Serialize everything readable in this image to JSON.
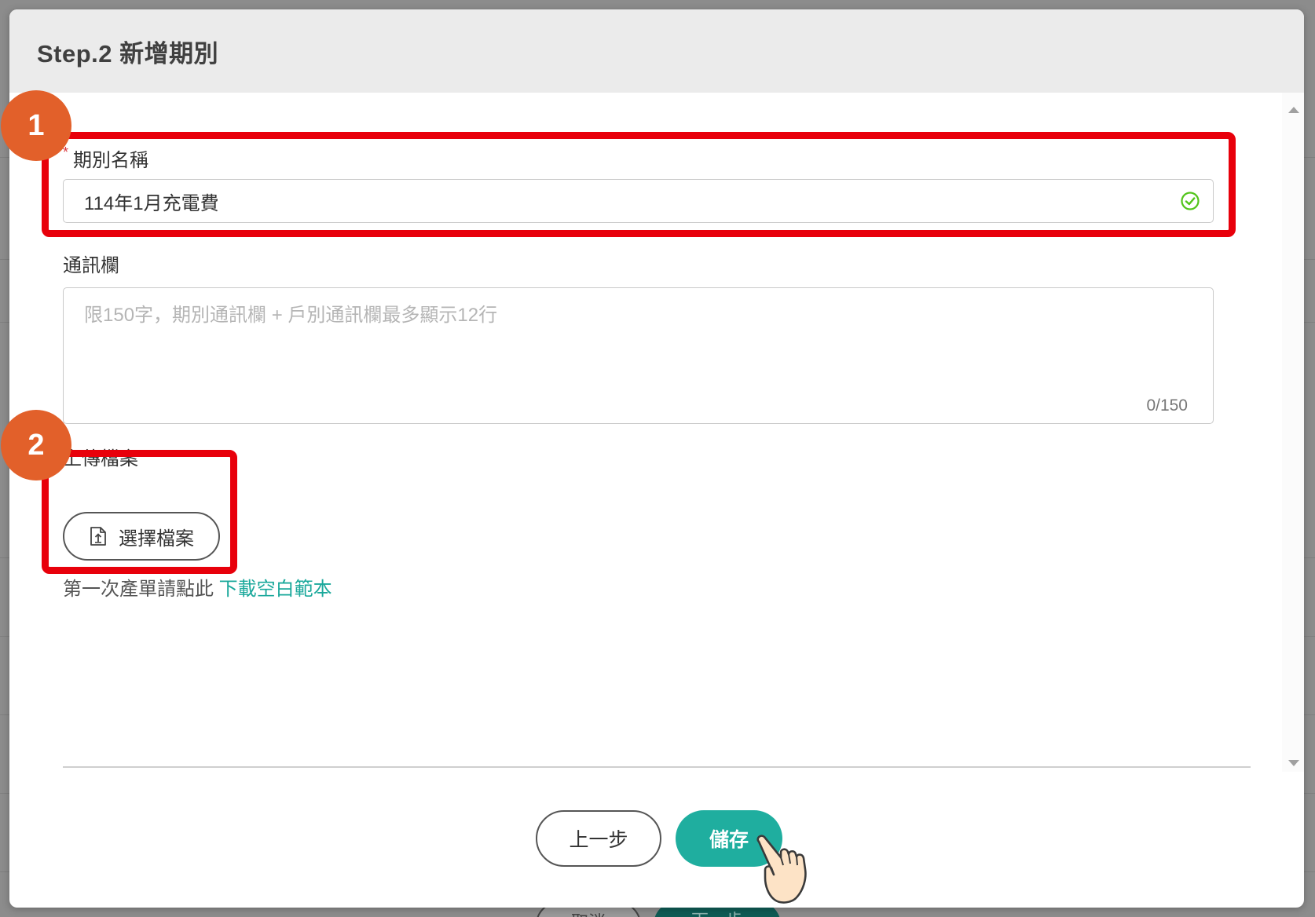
{
  "modal": {
    "title": "Step.2 新增期別"
  },
  "period_name": {
    "label": "期別名稱",
    "required_mark": "*",
    "value": "114年1月充電費"
  },
  "message": {
    "label": "通訊欄",
    "placeholder": "限150字，期別通訊欄 + 戶別通訊欄最多顯示12行",
    "counter": "0/150"
  },
  "upload": {
    "label": "上傳檔案",
    "button_label": "選擇檔案",
    "hint_text": "第一次產單請點此 ",
    "hint_link": "下載空白範本"
  },
  "footer": {
    "prev_label": "上一步",
    "save_label": "儲存"
  },
  "background": {
    "cancel_label": "取消",
    "next_label": "下一步"
  },
  "annotations": {
    "badge_1": "1",
    "badge_2": "2"
  },
  "colors": {
    "accent": "#1fae9f",
    "highlight": "#e8000b",
    "badge": "#e2602a",
    "valid_check": "#52c41a",
    "required": "#d9363e"
  }
}
